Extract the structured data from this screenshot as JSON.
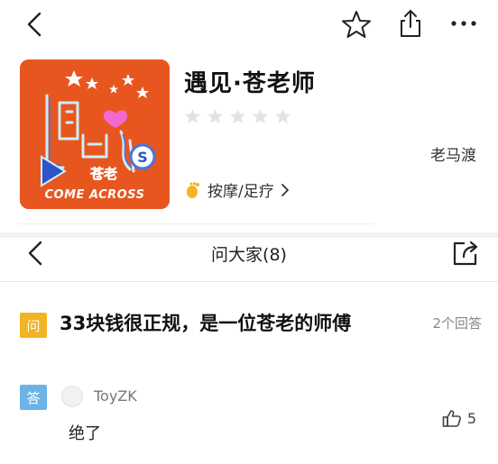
{
  "shop": {
    "title": "遇见·苍老师",
    "rating_stars": 0,
    "rating_max": 5,
    "author": "老马渡",
    "category": "按摩/足疗",
    "logo": {
      "cn_text": "遇见",
      "name_text": "苍老",
      "tagline": "COME ACROSS",
      "emblem_letter": "S"
    }
  },
  "qa": {
    "title": "问大家(8)",
    "question_badge": "问",
    "question": "33块钱很正规，是一位苍老的师傅",
    "answer_count": "2个回答",
    "answer_badge": "答",
    "answer_user": "ToyZK",
    "answer_text": "绝了",
    "likes": "5"
  },
  "colors": {
    "logo_bg": "#e8561f",
    "question_badge": "#f2b422",
    "answer_badge": "#6db3e8",
    "star_empty": "#e3e3e3"
  },
  "icons": [
    "back-arrow-icon",
    "star-outline-icon",
    "share-icon",
    "more-dots-icon",
    "foot-icon",
    "chevron-right-icon",
    "back-arrow-icon",
    "share-icon",
    "thumbs-up-icon"
  ]
}
